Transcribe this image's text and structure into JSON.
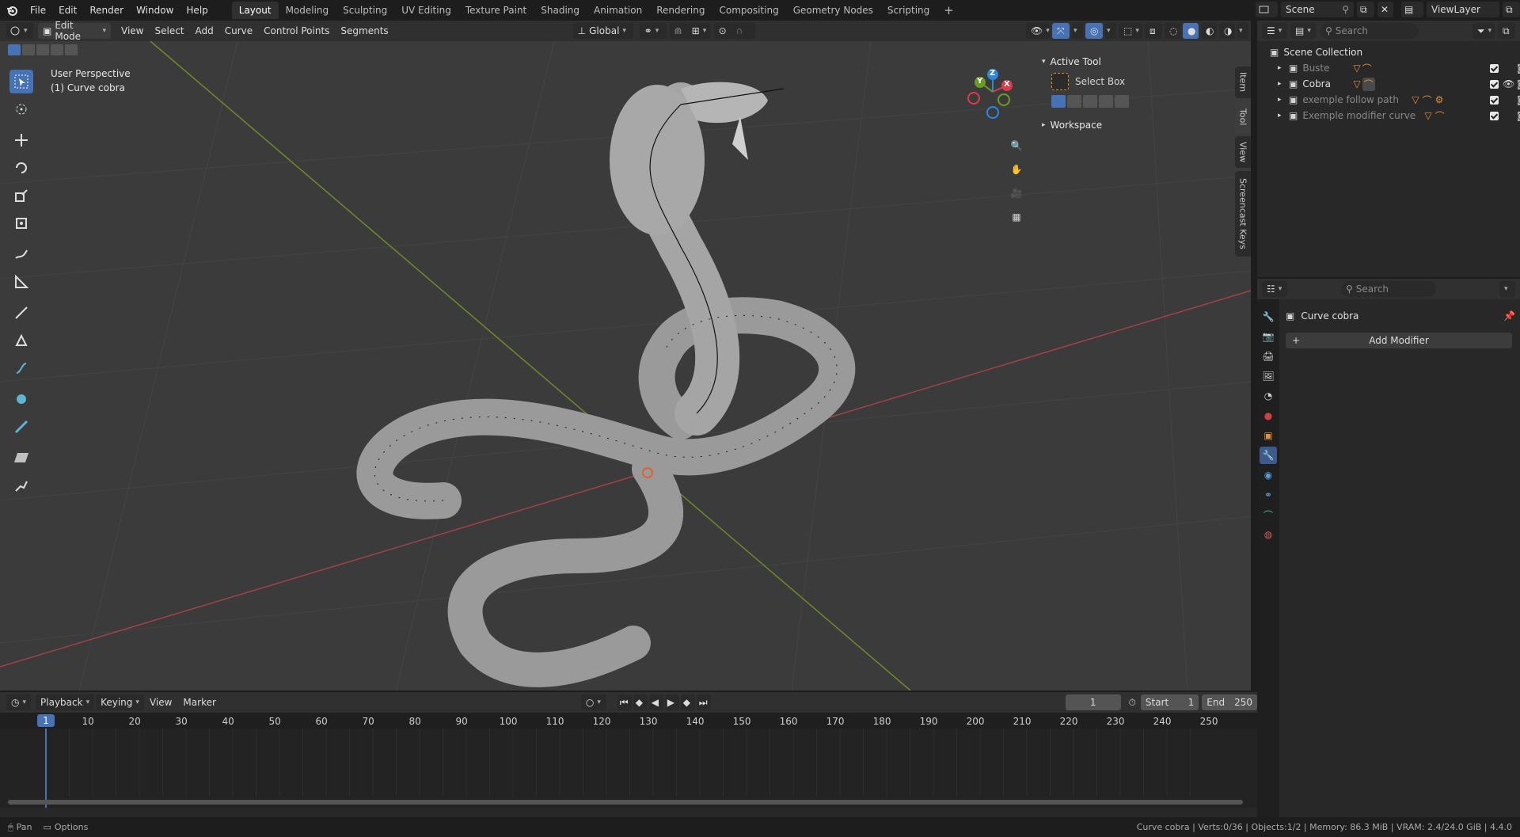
{
  "topbar": {
    "menus": [
      "File",
      "Edit",
      "Render",
      "Window",
      "Help"
    ],
    "workspaces": [
      "Layout",
      "Modeling",
      "Sculpting",
      "UV Editing",
      "Texture Paint",
      "Shading",
      "Animation",
      "Rendering",
      "Compositing",
      "Geometry Nodes",
      "Scripting"
    ],
    "active_workspace": "Layout",
    "add_tab": "+",
    "scene": "Scene",
    "view_layer": "ViewLayer"
  },
  "viewport_header": {
    "mode": "Edit Mode",
    "menus": [
      "View",
      "Select",
      "Add",
      "Curve",
      "Control Points",
      "Segments"
    ],
    "transform_orientation": "Global"
  },
  "viewport": {
    "perspective": "User Perspective",
    "object_label": "(1) Curve cobra",
    "gizmo_axes": {
      "z": "Z",
      "y": "Y",
      "x": "X"
    },
    "colors": {
      "x": "#db3c4a",
      "y": "#6b9b23",
      "z": "#2f86dd",
      "bg": "#3b3b3b"
    }
  },
  "sidebar": {
    "active_tool_title": "Active Tool",
    "tool_name": "Select Box",
    "workspace_title": "Workspace",
    "tabs": [
      "Item",
      "Tool",
      "View",
      "Screencast Keys"
    ]
  },
  "outliner": {
    "search_placeholder": "Search",
    "collection": "Scene Collection",
    "items": [
      {
        "name": "Buste",
        "dim": true
      },
      {
        "name": "Cobra",
        "dim": false
      },
      {
        "name": "exemple follow path",
        "dim": true
      },
      {
        "name": "Exemple modifier curve",
        "dim": true
      }
    ]
  },
  "properties": {
    "search_placeholder": "Search",
    "object_name": "Curve cobra",
    "add_modifier": "Add Modifier",
    "add_icon": "+"
  },
  "timeline": {
    "menus": [
      "Playback",
      "Keying",
      "View",
      "Marker"
    ],
    "current_frame": "1",
    "start_label": "Start",
    "start_value": "1",
    "end_label": "End",
    "end_value": "250",
    "playhead_label": "1",
    "ticks": [
      "10",
      "20",
      "30",
      "40",
      "50",
      "60",
      "70",
      "80",
      "90",
      "100",
      "110",
      "120",
      "130",
      "140",
      "150",
      "160",
      "170",
      "180",
      "190",
      "200",
      "210",
      "220",
      "230",
      "240",
      "250"
    ]
  },
  "statusbar": {
    "pan": "Pan",
    "options": "Options",
    "info": "Curve cobra | Verts:0/36 | Objects:1/2 | Memory: 86.3 MiB | VRAM: 2.4/24.0 GiB | 4.4.0"
  }
}
